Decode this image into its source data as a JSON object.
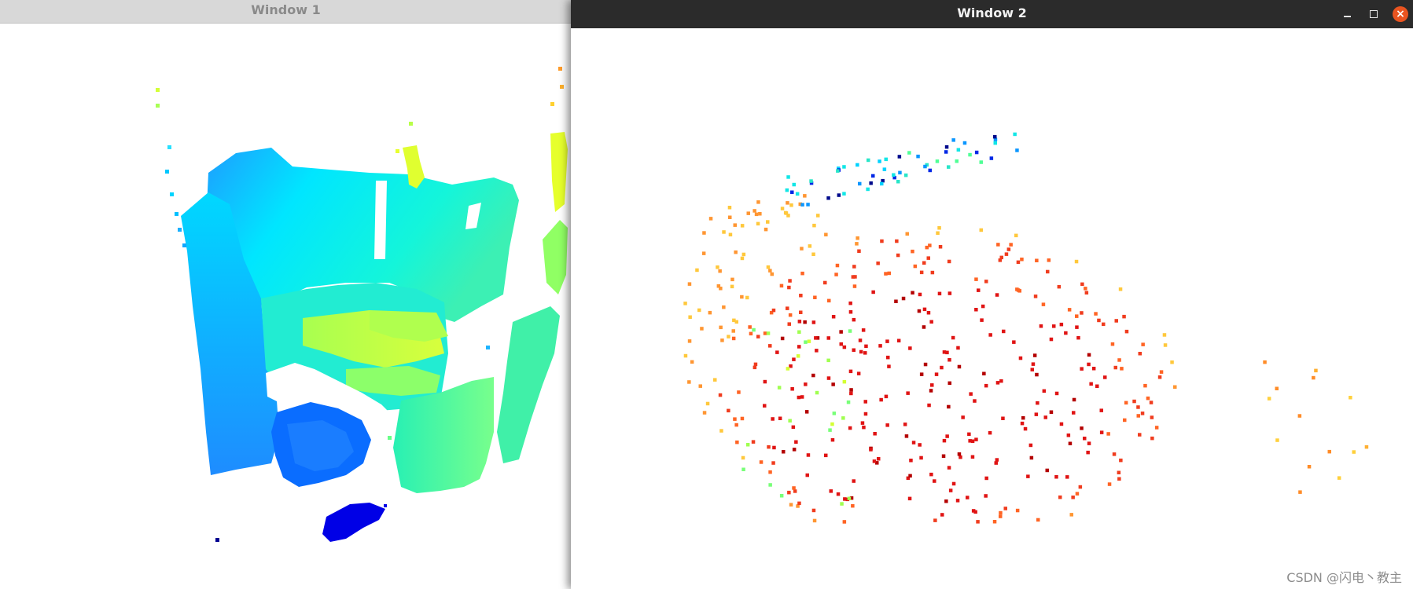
{
  "window1": {
    "title": "Window 1"
  },
  "window2": {
    "title": "Window 2",
    "controls": {
      "minimize": "minimize-icon",
      "maximize": "maximize-icon",
      "close": "close-icon"
    }
  },
  "watermark": "CSDN @闪电丶教主",
  "colors": {
    "window2_titlebar": "#2b2b2b",
    "window1_titlebar": "#d8d8d8",
    "close_button": "#e95420",
    "canvas_background": "#ffffff"
  }
}
